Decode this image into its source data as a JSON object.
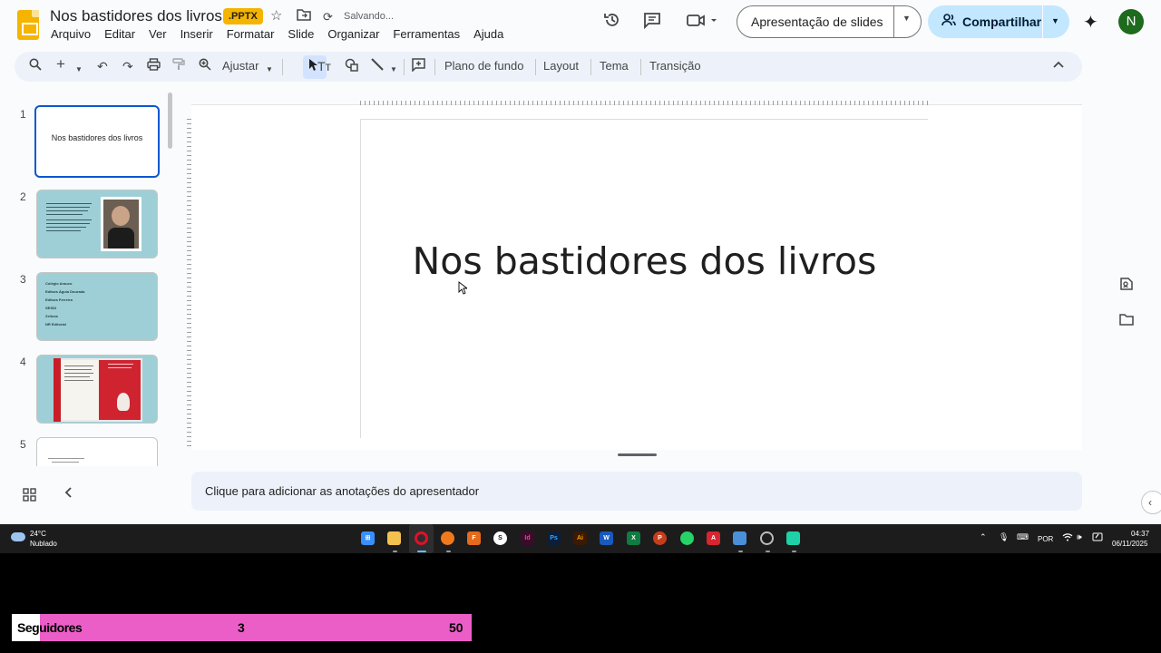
{
  "header": {
    "doc_title": "Nos bastidores dos livros",
    "badge": ".PPTX",
    "status": "Salvando...",
    "menu": [
      "Arquivo",
      "Editar",
      "Ver",
      "Inserir",
      "Formatar",
      "Slide",
      "Organizar",
      "Ferramentas",
      "Ajuda"
    ],
    "slideshow_label": "Apresentação de slides",
    "share_label": "Compartilhar",
    "avatar_initial": "N"
  },
  "toolbar": {
    "zoom_label": "Ajustar",
    "background_label": "Plano de fundo",
    "layout_label": "Layout",
    "theme_label": "Tema",
    "transition_label": "Transição"
  },
  "filmstrip": {
    "slides": [
      {
        "number": "1",
        "title": "Nos bastidores dos livros"
      },
      {
        "number": "2"
      },
      {
        "number": "3",
        "lines": [
          "Colégio Arauco",
          "Editora Águia Dourada",
          "Editora Ferreira",
          "SESDI",
          "Zelinea",
          "NR Editorial"
        ]
      },
      {
        "number": "4"
      },
      {
        "number": "5"
      }
    ]
  },
  "slide": {
    "title": "Nos bastidores dos livros"
  },
  "notes": {
    "placeholder": "Clique para adicionar as anotações do apresentador"
  },
  "taskbar": {
    "weather_temp": "24°C",
    "weather_desc": "Nublado",
    "lang": "POR",
    "time": "04:37",
    "date": "06/11/2025"
  },
  "overlay": {
    "label": "Seguidores",
    "current": "3",
    "goal": "50"
  },
  "colors": {
    "accent": "#0b57d0",
    "share_bg": "#c2e7ff",
    "slide_teal": "#9fcfd6",
    "overlay_pink": "#eb5ec8",
    "slides_yellow": "#f5b400"
  }
}
